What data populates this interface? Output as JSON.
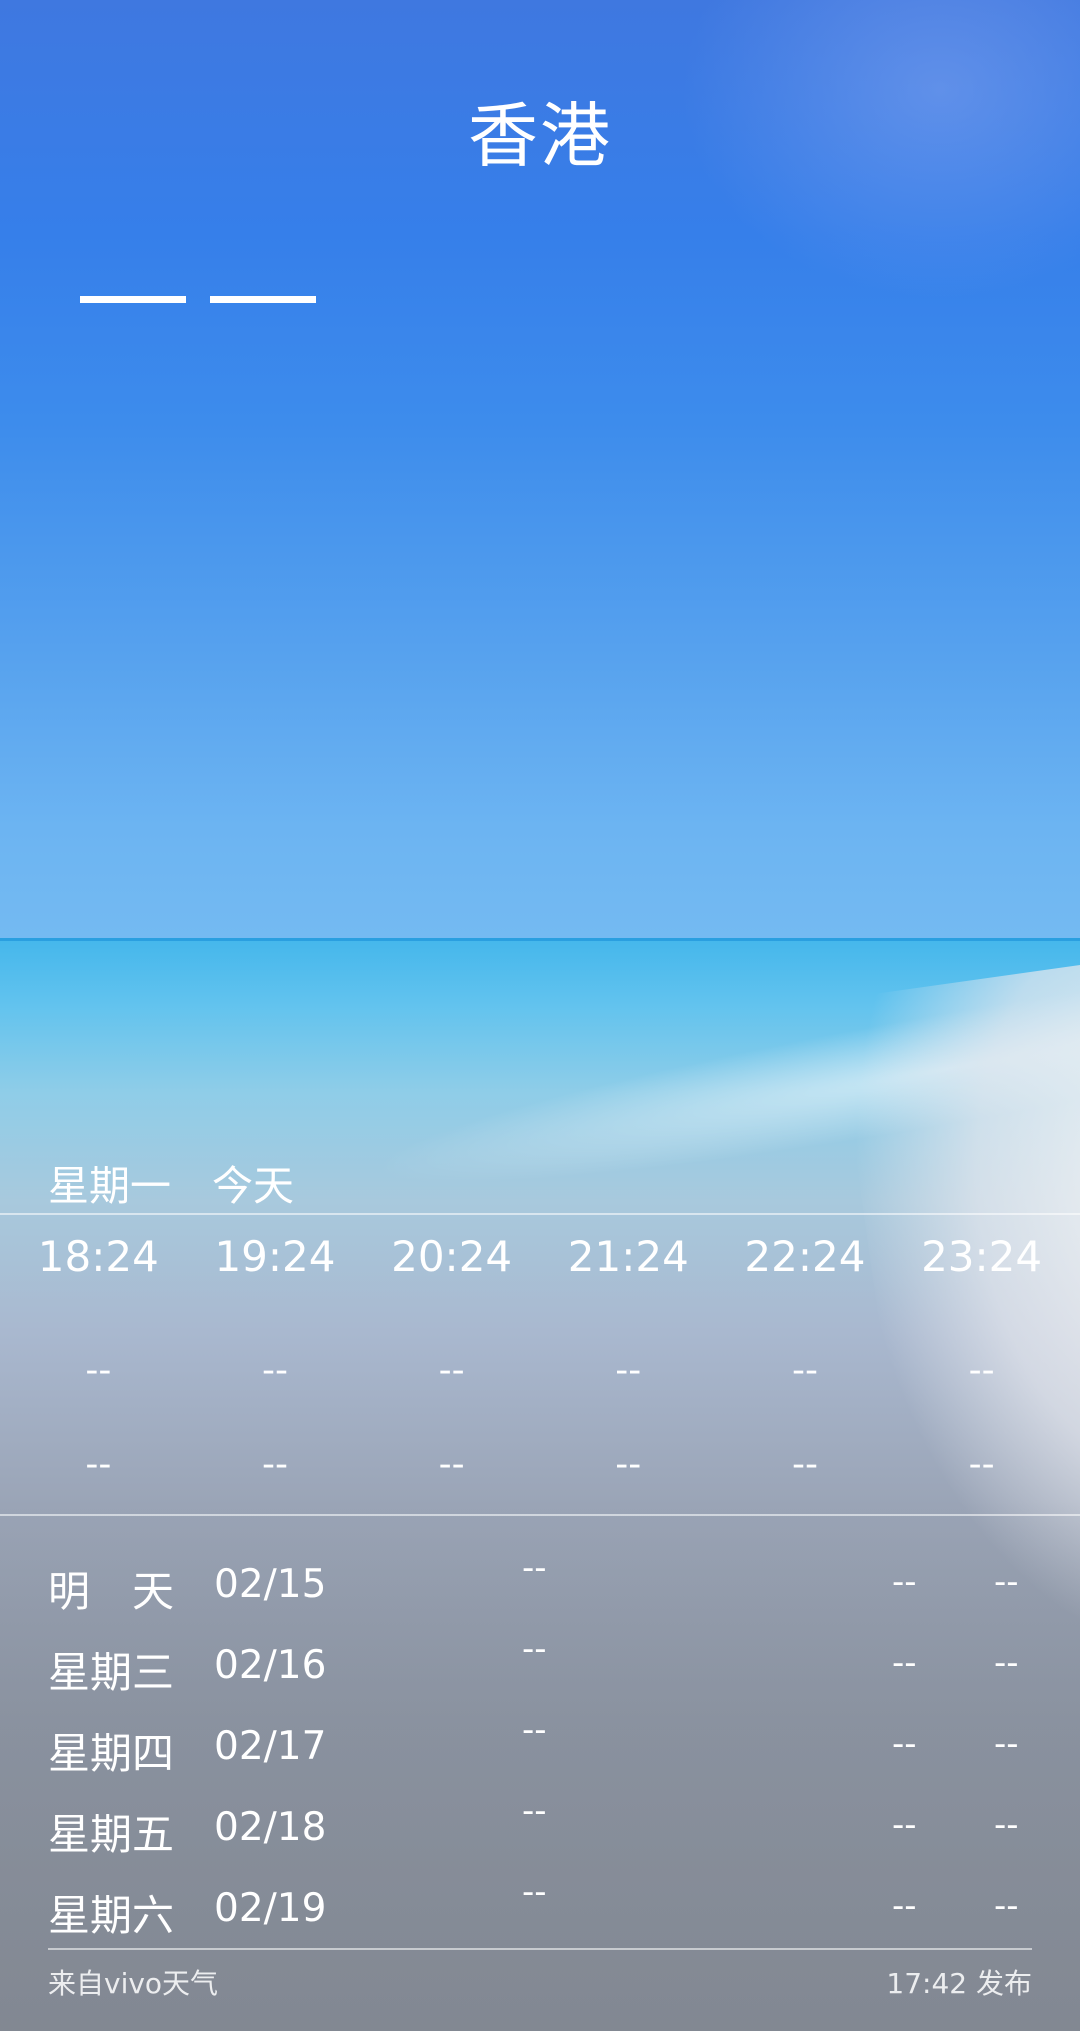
{
  "header": {
    "city": "香港"
  },
  "today_row": {
    "weekday": "星期一",
    "label": "今天"
  },
  "hourly": [
    {
      "time": "18:24",
      "v1": "--",
      "v2": "--"
    },
    {
      "time": "19:24",
      "v1": "--",
      "v2": "--"
    },
    {
      "time": "20:24",
      "v1": "--",
      "v2": "--"
    },
    {
      "time": "21:24",
      "v1": "--",
      "v2": "--"
    },
    {
      "time": "22:24",
      "v1": "--",
      "v2": "--"
    },
    {
      "time": "23:24",
      "v1": "--",
      "v2": "--"
    }
  ],
  "daily": [
    {
      "name": "明　天",
      "date": "02/15",
      "cond": "--",
      "lo": "--",
      "hi": "--"
    },
    {
      "name": "星期三",
      "date": "02/16",
      "cond": "--",
      "lo": "--",
      "hi": "--"
    },
    {
      "name": "星期四",
      "date": "02/17",
      "cond": "--",
      "lo": "--",
      "hi": "--"
    },
    {
      "name": "星期五",
      "date": "02/18",
      "cond": "--",
      "lo": "--",
      "hi": "--"
    },
    {
      "name": "星期六",
      "date": "02/19",
      "cond": "--",
      "lo": "--",
      "hi": "--"
    }
  ],
  "footer": {
    "source": "来自vivo天气",
    "published": "17:42 发布"
  }
}
